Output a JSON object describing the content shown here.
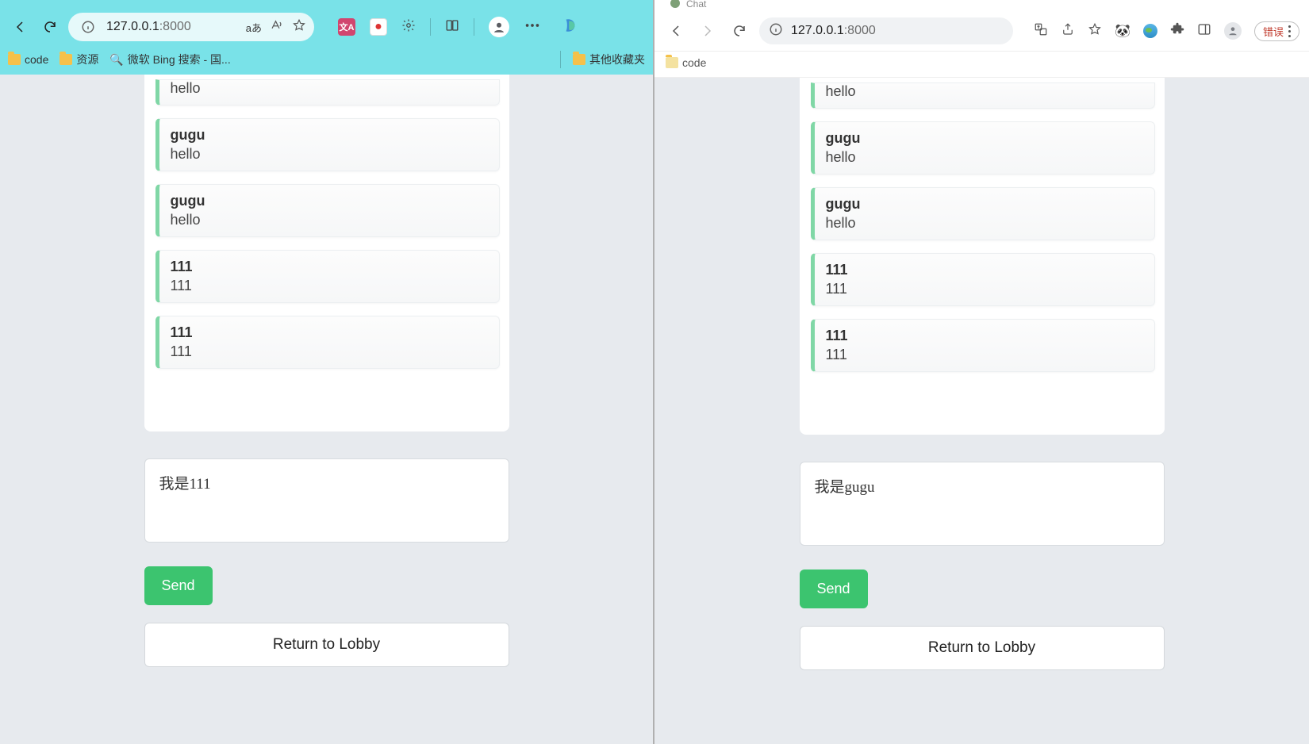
{
  "left": {
    "chrome": {
      "url_host": "127.0.0.1",
      "url_port": ":8000",
      "lang_badge": "aあ",
      "bm_code": "code",
      "bm_res": "资源",
      "bm_bing": "微软 Bing 搜索 - 国...",
      "bm_other": "其他收藏夹"
    },
    "chat": {
      "messages": [
        {
          "user": "",
          "text": "hello",
          "partial": true
        },
        {
          "user": "gugu",
          "text": "hello"
        },
        {
          "user": "gugu",
          "text": "hello"
        },
        {
          "user": "111",
          "text": "111"
        },
        {
          "user": "111",
          "text": "111"
        }
      ],
      "composer_value": "我是111",
      "send_label": "Send",
      "lobby_label": "Return to Lobby"
    }
  },
  "right": {
    "chrome": {
      "tab_stub": "Chat",
      "url_host": "127.0.0.1",
      "url_port": ":8000",
      "err_label": "错误",
      "bm_code": "code"
    },
    "chat": {
      "messages": [
        {
          "user": "",
          "text": "hello",
          "partial": true
        },
        {
          "user": "gugu",
          "text": "hello"
        },
        {
          "user": "gugu",
          "text": "hello"
        },
        {
          "user": "111",
          "text": "111"
        },
        {
          "user": "111",
          "text": "111"
        }
      ],
      "composer_value": "我是gugu",
      "send_label": "Send",
      "lobby_label": "Return to Lobby"
    }
  }
}
